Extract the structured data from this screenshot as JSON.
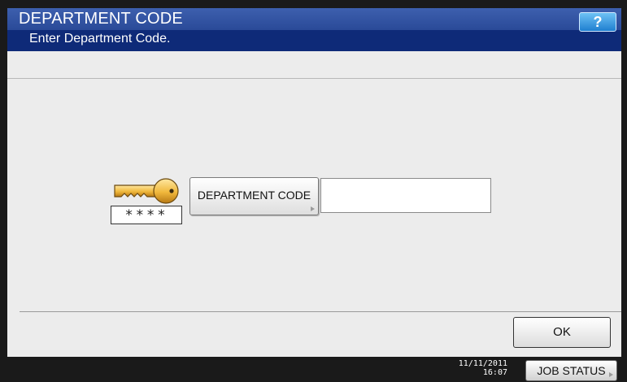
{
  "header": {
    "title": "DEPARTMENT CODE",
    "subtitle": "Enter Department Code.",
    "help_label": "?"
  },
  "main": {
    "masked_code": "****",
    "department_code_button_label": "DEPARTMENT CODE",
    "department_code_value": ""
  },
  "footer": {
    "ok_label": "OK",
    "date": "11/11/2011",
    "time": "16:07",
    "job_status_label": "JOB STATUS"
  },
  "colors": {
    "title_bar": "#0e2a78",
    "help_button": "#1f7fd0",
    "content_background": "#ececec",
    "status_bar": "#1a1a1a"
  }
}
